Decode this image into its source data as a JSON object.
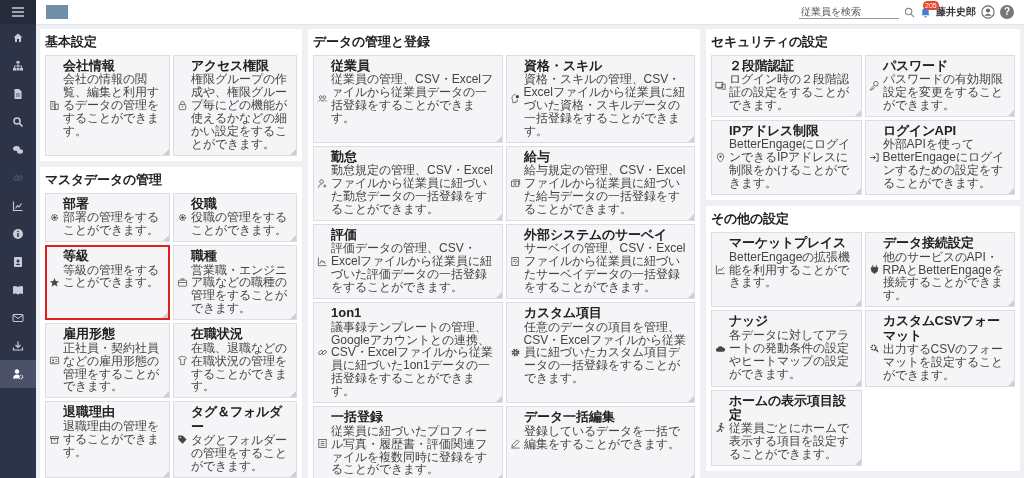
{
  "topbar": {
    "search": {
      "placeholder": "従業員を検索"
    },
    "notification_count": "205",
    "user_name": "藤井史郎",
    "help_label": "?"
  },
  "sidebar": {
    "items": [
      {
        "selected": false,
        "disabled": false
      },
      {
        "selected": false,
        "disabled": false
      },
      {
        "selected": false,
        "disabled": false
      },
      {
        "selected": false,
        "disabled": false
      },
      {
        "selected": false,
        "disabled": false
      },
      {
        "selected": false,
        "disabled": true
      },
      {
        "selected": false,
        "disabled": false
      },
      {
        "selected": false,
        "disabled": false
      },
      {
        "selected": false,
        "disabled": false
      },
      {
        "selected": false,
        "disabled": false
      },
      {
        "selected": false,
        "disabled": false
      },
      {
        "selected": false,
        "disabled": false
      },
      {
        "selected": true,
        "disabled": false
      }
    ]
  },
  "columns": [
    [
      {
        "title": "基本設定",
        "cards": [
          {
            "title": "会社情報",
            "description": "会社の情報の閲覧、編集と利用するデータの管理をすることができます。",
            "highlighted": false
          },
          {
            "title": "アクセス権限",
            "description": "権限グループの作成や、権限グループ毎にどの機能が使えるかなどの細かい設定をすることができます。",
            "highlighted": false
          }
        ]
      },
      {
        "title": "マスタデータの管理",
        "cards": [
          {
            "title": "部署",
            "description": "部署の管理をすることができます。",
            "highlighted": false
          },
          {
            "title": "役職",
            "description": "役職の管理をすることができます。",
            "highlighted": false
          },
          {
            "title": "等級",
            "description": "等級の管理をすることができます。",
            "highlighted": true
          },
          {
            "title": "職種",
            "description": "営業職・エンジニア職などの職種の管理をすることができます。",
            "highlighted": false
          },
          {
            "title": "雇用形態",
            "description": "正社員・契約社員などの雇用形態の管理をすることができます。",
            "highlighted": false
          },
          {
            "title": "在職状況",
            "description": "在職、退職などの在職状況の管理をすることができます。",
            "highlighted": false
          },
          {
            "title": "退職理由",
            "description": "退職理由の管理をすることができます。",
            "highlighted": false
          },
          {
            "title": "タグ＆フォルダー",
            "description": "タグとフォルダーの管理をすることができます。",
            "highlighted": false
          }
        ]
      }
    ],
    [
      {
        "title": "データの管理と登録",
        "cards": [
          {
            "title": "従業員",
            "description": "従業員の管理、CSV・Excelファイルから従業員データの一括登録をすることができます。",
            "highlighted": false
          },
          {
            "title": "資格・スキル",
            "description": "資格・スキルの管理、CSV・Excelファイルから従業員に紐づいた資格・スキルデータの一括登録をすることができます。",
            "highlighted": false
          },
          {
            "title": "勤怠",
            "description": "勤怠規定の管理、CSV・Excelファイルから従業員に紐づいた勤怠データの一括登録をすることができます。",
            "highlighted": false
          },
          {
            "title": "給与",
            "description": "給与規定の管理、CSV・Excelファイルから従業員に紐づいた給与データの一括登録をすることができます。",
            "highlighted": false
          },
          {
            "title": "評価",
            "description": "評価データの管理、CSV・Excelファイルから従業員に紐づいた評価データの一括登録をすることができます。",
            "highlighted": false
          },
          {
            "title": "外部システムのサーベイ",
            "description": "サーベイの管理、CSV・Excelファイルから従業員に紐づいたサーベイデータの一括登録をすることができます。",
            "highlighted": false
          },
          {
            "title": "1on1",
            "description": "議事録テンプレートの管理、Googleアカウントとの連携、CSV・Excelファイルから従業員に紐づいた1on1データの一括登録をすることができます。",
            "highlighted": false
          },
          {
            "title": "カスタム項目",
            "description": "任意のデータの項目を管理、CSV・Excelファイルから従業員に紐づいたカスタム項目データの一括登録をすることができます。",
            "highlighted": false
          },
          {
            "title": "一括登録",
            "description": "従業員に紐づいたプロフィール写真・履歴書・評価関連ファイルを複数同時に登録をすることができます。",
            "highlighted": false
          },
          {
            "title": "データ一括編集",
            "description": "登録しているデータを一括で編集をすることができます。",
            "highlighted": false
          }
        ]
      }
    ],
    [
      {
        "title": "セキュリティの設定",
        "cards": [
          {
            "title": "２段階認証",
            "description": "ログイン時の２段階認証の設定をすることができます。",
            "highlighted": false
          },
          {
            "title": "パスワード",
            "description": "パスワードの有効期限設定を変更をすることができます。",
            "highlighted": false
          },
          {
            "title": "IPアドレス制限",
            "description": "BetterEngageにログインできるIPアドレスに制限をかけることができます。",
            "highlighted": false
          },
          {
            "title": "ログインAPI",
            "description": "外部APIを使ってBetterEngageにログインするための設定をすることができます。",
            "highlighted": false
          }
        ]
      },
      {
        "title": "その他の設定",
        "cards": [
          {
            "title": "マーケットプレイス",
            "description": "BetterEngageの拡張機能を利用することができます。",
            "highlighted": false
          },
          {
            "title": "データ接続設定",
            "description": "他のサービスのAPI・RPAとBetterEngageを接続することができます。",
            "highlighted": false
          },
          {
            "title": "ナッジ",
            "description": "各データに対してアラートの発動条件の設定やヒートマップの設定ができます。",
            "highlighted": false
          },
          {
            "title": "カスタムCSVフォーマット",
            "description": "出力するCSVのフォーマットを設定することができます。",
            "highlighted": false
          },
          {
            "title": "ホームの表示項目設定",
            "description": "従業員ごとにホームで表示する項目を設定することができます。",
            "highlighted": false
          }
        ]
      }
    ]
  ]
}
